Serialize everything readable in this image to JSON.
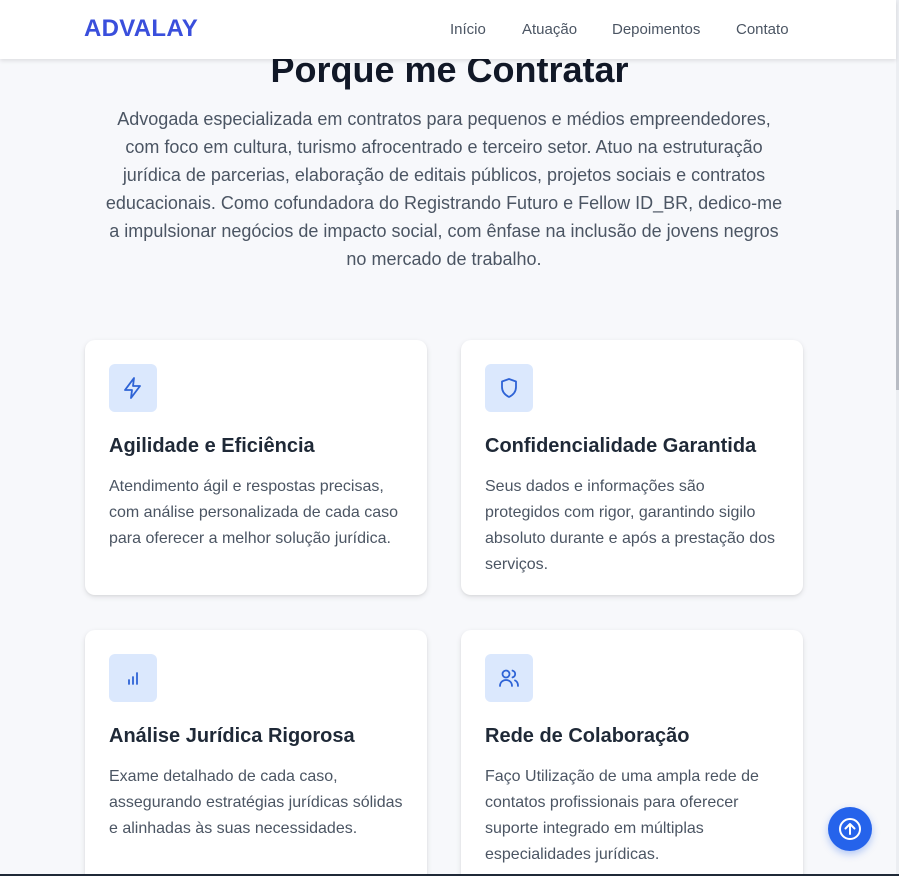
{
  "nav": {
    "brand": "ADVALAY",
    "links": [
      "Início",
      "Atuação",
      "Depoimentos",
      "Contato"
    ]
  },
  "section": {
    "title": "Porque me Contratar",
    "intro": "Advogada especializada em contratos para pequenos e médios empreendedores, com foco em cultura, turismo afrocentrado e terceiro setor. Atuo na estruturação jurídica de parcerias, elaboração de editais públicos, projetos sociais e contratos educacionais. Como cofundadora do Registrando Futuro e Fellow ID_BR, dedico-me a impulsionar negócios de impacto social, com ênfase na inclusão de jovens negros no mercado de trabalho."
  },
  "cards": [
    {
      "icon": "lightning-icon",
      "title": "Agilidade e Eficiência",
      "text": "Atendimento ágil e respostas precisas, com análise personalizada de cada caso para oferecer a melhor solução jurídica."
    },
    {
      "icon": "shield-icon",
      "title": "Confidencialidade Garantida",
      "text": "Seus dados e informações são protegidos com rigor, garantindo sigilo absoluto durante e após a prestação dos serviços."
    },
    {
      "icon": "bar-chart-icon",
      "title": "Análise Jurídica Rigorosa",
      "text": "Exame detalhado de cada caso, assegurando estratégias jurídicas sólidas e alinhadas às suas necessidades."
    },
    {
      "icon": "users-icon",
      "title": "Rede de Colaboração",
      "text": "Faço Utilização de uma ampla rede de contatos profissionais para oferecer suporte integrado em múltiplas especialidades jurídicas."
    }
  ],
  "colors": {
    "brand": "#3a4fdc",
    "accent": "#2563eb",
    "icon_bg": "#dbe8fd",
    "background": "#f7f8fb"
  },
  "back_to_top": {
    "icon": "arrow-up-circle-icon"
  }
}
